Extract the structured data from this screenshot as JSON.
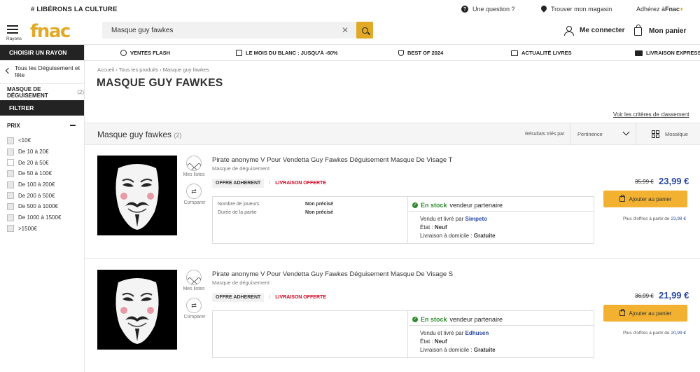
{
  "topbar": {
    "slogan": "# LIBÉRONS LA CULTURE",
    "question": "Une question ?",
    "store": "Trouver mon magasin",
    "adhere_prefix": "Adhérez à ",
    "adhere_brand": "Fnac",
    "adhere_plus": "+"
  },
  "header": {
    "menu_label": "Rayons",
    "logo": "fnac",
    "search_value": "Masque guy fawkes",
    "login": "Me connecter",
    "cart": "Mon panier"
  },
  "sidebar": {
    "choose_label": "CHOISIR UN RAYON",
    "back_label": "Tous les Déguisement et fête",
    "category": "MASQUE DE DÉGUISEMENT",
    "category_count": "(2)",
    "filter_label": "FILTRER",
    "price_label": "PRIX",
    "price_ranges": [
      "<10€",
      "De 10 à 20€",
      "De 20 à 50€",
      "De 50 à 100€",
      "De 100 à 200€",
      "De 200 à 500€",
      "De 500 à 1000€",
      "De 1000 à 1500€",
      ">1500€"
    ]
  },
  "nav": {
    "items": [
      {
        "label": "VENTES FLASH",
        "icon": "clock-icon"
      },
      {
        "label": "LE MOIS DU BLANC : JUSQU'À -60%",
        "icon": "tv-icon"
      },
      {
        "label": "BEST OF 2024",
        "icon": "trophy-icon"
      },
      {
        "label": "ACTUALITÉ LIVRES",
        "icon": "book-icon"
      },
      {
        "label": "LIVRAISON EXPRESS OFFE",
        "icon": "truck-icon"
      }
    ]
  },
  "main": {
    "breadcrumb": "Accueil › Tous les produits › Masque guy fawkes",
    "title": "MASQUE GUY FAWKES",
    "criteria_link": "Voir les critères de classement",
    "list_title": "Masque guy fawkes",
    "list_count": "(2)",
    "sorted_by": "Résultats triés par",
    "sort_value": "Pertinence",
    "view_label": "Mosaïque"
  },
  "labels": {
    "wishlist": "Mes listes",
    "compare": "Comparer",
    "badge_member": "OFFRE ADHERENT",
    "badge_sep": "/",
    "badge_delivery": "LIVRAISON OFFERTE",
    "stock_status": "En stock",
    "stock_suffix": "vendeur partenaire",
    "sold_by": "Vendu et livré par ",
    "state_prefix": "État : ",
    "delivery_prefix": "Livraison à domicile : ",
    "add_to_cart": "Ajouter au panier",
    "more_offers": "Plus d'offres à partir de "
  },
  "products": [
    {
      "title": "Pirate anonyme V Pour Vendetta Guy Fawkes Déguisement Masque De Visage T",
      "category": "Masque de déguisement",
      "attributes": [
        {
          "name": "Nombre de joueurs",
          "value": "Non précisé"
        },
        {
          "name": "Durée de la partie",
          "value": "Non précisé"
        }
      ],
      "seller": "Simpeto",
      "state": "Neuf",
      "delivery": "Gratuite",
      "old_price": "35,99 €",
      "price": "23,99 €",
      "from_price": "23,98 €"
    },
    {
      "title": "Pirate anonyme V Pour Vendetta Guy Fawkes Déguisement Masque De Visage S",
      "category": "Masque de déguisement",
      "attributes": [],
      "seller": "Edhusen",
      "state": "Neuf",
      "delivery": "Gratuite",
      "old_price": "36,99 €",
      "price": "21,99 €",
      "from_price": "20,99 €"
    }
  ],
  "colors": {
    "brand": "#e1a925",
    "cart_button": "#f2b130",
    "price": "#2a4a9e",
    "stock": "#2e8b2e",
    "delivery_badge": "#d2001c"
  }
}
